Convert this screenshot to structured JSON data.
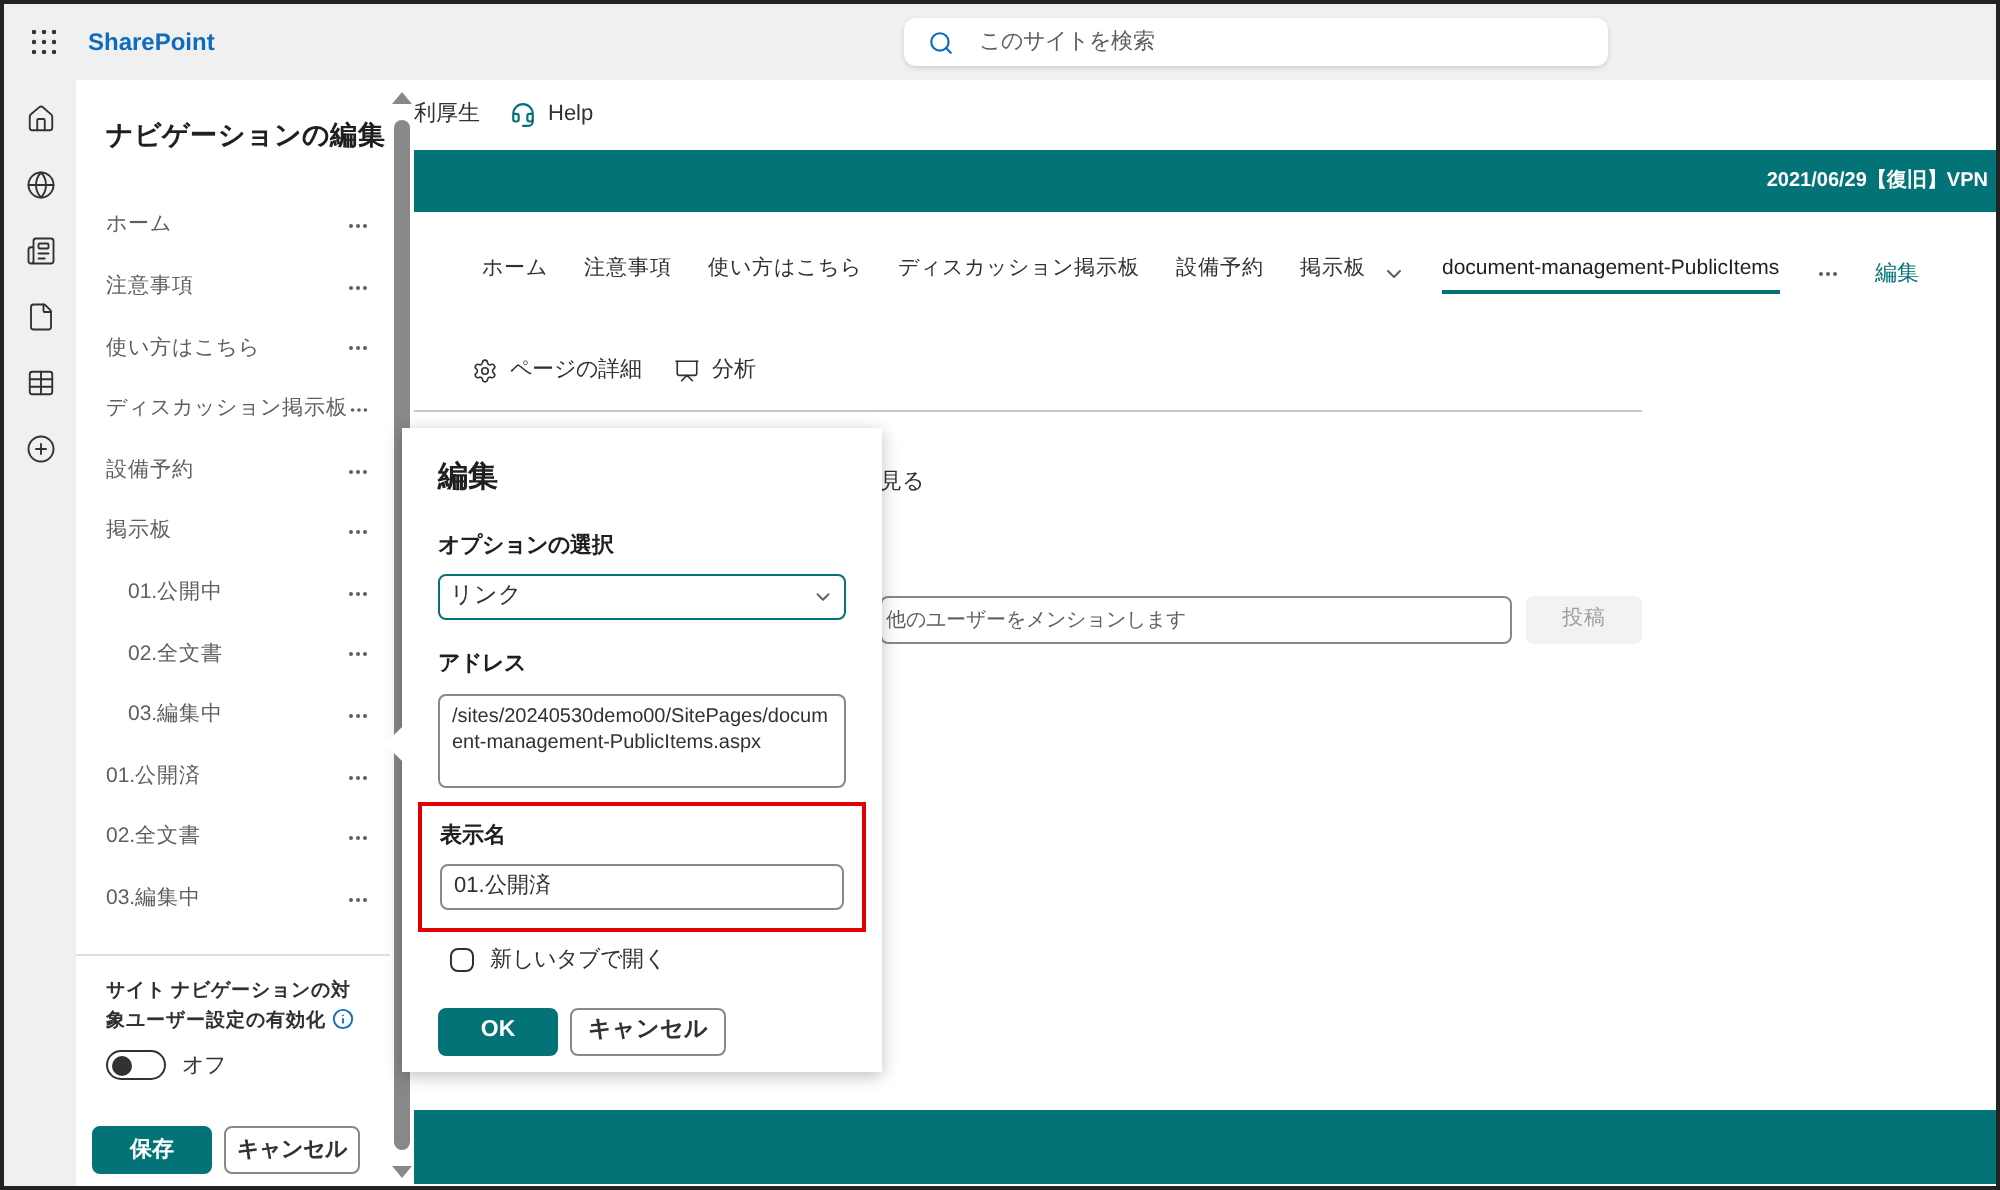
{
  "app_bar": {
    "brand": "SharePoint",
    "search": {
      "placeholder": "このサイトを検索"
    }
  },
  "nav_editor": {
    "title": "ナビゲーションの編集",
    "items": [
      {
        "label": "ホーム"
      },
      {
        "label": "注意事項"
      },
      {
        "label": "使い方はこちら"
      },
      {
        "label": "ディスカッション掲示板"
      },
      {
        "label": "設備予約"
      },
      {
        "label": "掲示板",
        "children": [
          {
            "label": "01.公開中"
          },
          {
            "label": "02.全文書"
          },
          {
            "label": "03.編集中"
          }
        ]
      },
      {
        "label": "01.公開済"
      },
      {
        "label": "02.全文書"
      },
      {
        "label": "03.編集中"
      }
    ],
    "audience": {
      "label": "サイト ナビゲーションの対象ユーザー設定の有効化",
      "on": false,
      "state_label": "オフ"
    },
    "buttons": [
      {
        "label": "保存",
        "kind": "primary"
      },
      {
        "label": "キャンセル",
        "kind": "secondary"
      }
    ]
  },
  "site": {
    "header_text": "利厚生",
    "help": "Help",
    "banner": "2021/06/29【復旧】VPN",
    "nav": [
      {
        "label": "ホーム",
        "selected": false,
        "dropdown": false
      },
      {
        "label": "注意事項",
        "selected": false,
        "dropdown": false
      },
      {
        "label": "使い方はこちら",
        "selected": false,
        "dropdown": false
      },
      {
        "label": "ディスカッション掲示板",
        "selected": false,
        "dropdown": false
      },
      {
        "label": "設備予約",
        "selected": false,
        "dropdown": false
      },
      {
        "label": "掲示板",
        "selected": false,
        "dropdown": true
      },
      {
        "label": "document-management-PublicItems",
        "selected": true,
        "dropdown": false
      }
    ],
    "edit_link": "編集",
    "commands": [
      {
        "label": "ページの詳細",
        "kind": "details"
      },
      {
        "label": "分析",
        "kind": "analytics"
      }
    ],
    "see_more": "見る",
    "comment": {
      "placeholder": "他のユーザーをメンションします",
      "post": "投稿"
    }
  },
  "dialog": {
    "title": "編集",
    "option": {
      "label": "オプションの選択",
      "value": "リンク"
    },
    "address": {
      "label": "アドレス",
      "value": "/sites/20240530demo00/SitePages/document-management-PublicItems.aspx"
    },
    "display_name": {
      "label": "表示名",
      "value": "01.公開済",
      "highlighted": true
    },
    "new_tab": {
      "label": "新しいタブで開く",
      "checked": false
    },
    "buttons": [
      {
        "label": "OK",
        "kind": "primary"
      },
      {
        "label": "キャンセル",
        "kind": "secondary"
      }
    ]
  }
}
